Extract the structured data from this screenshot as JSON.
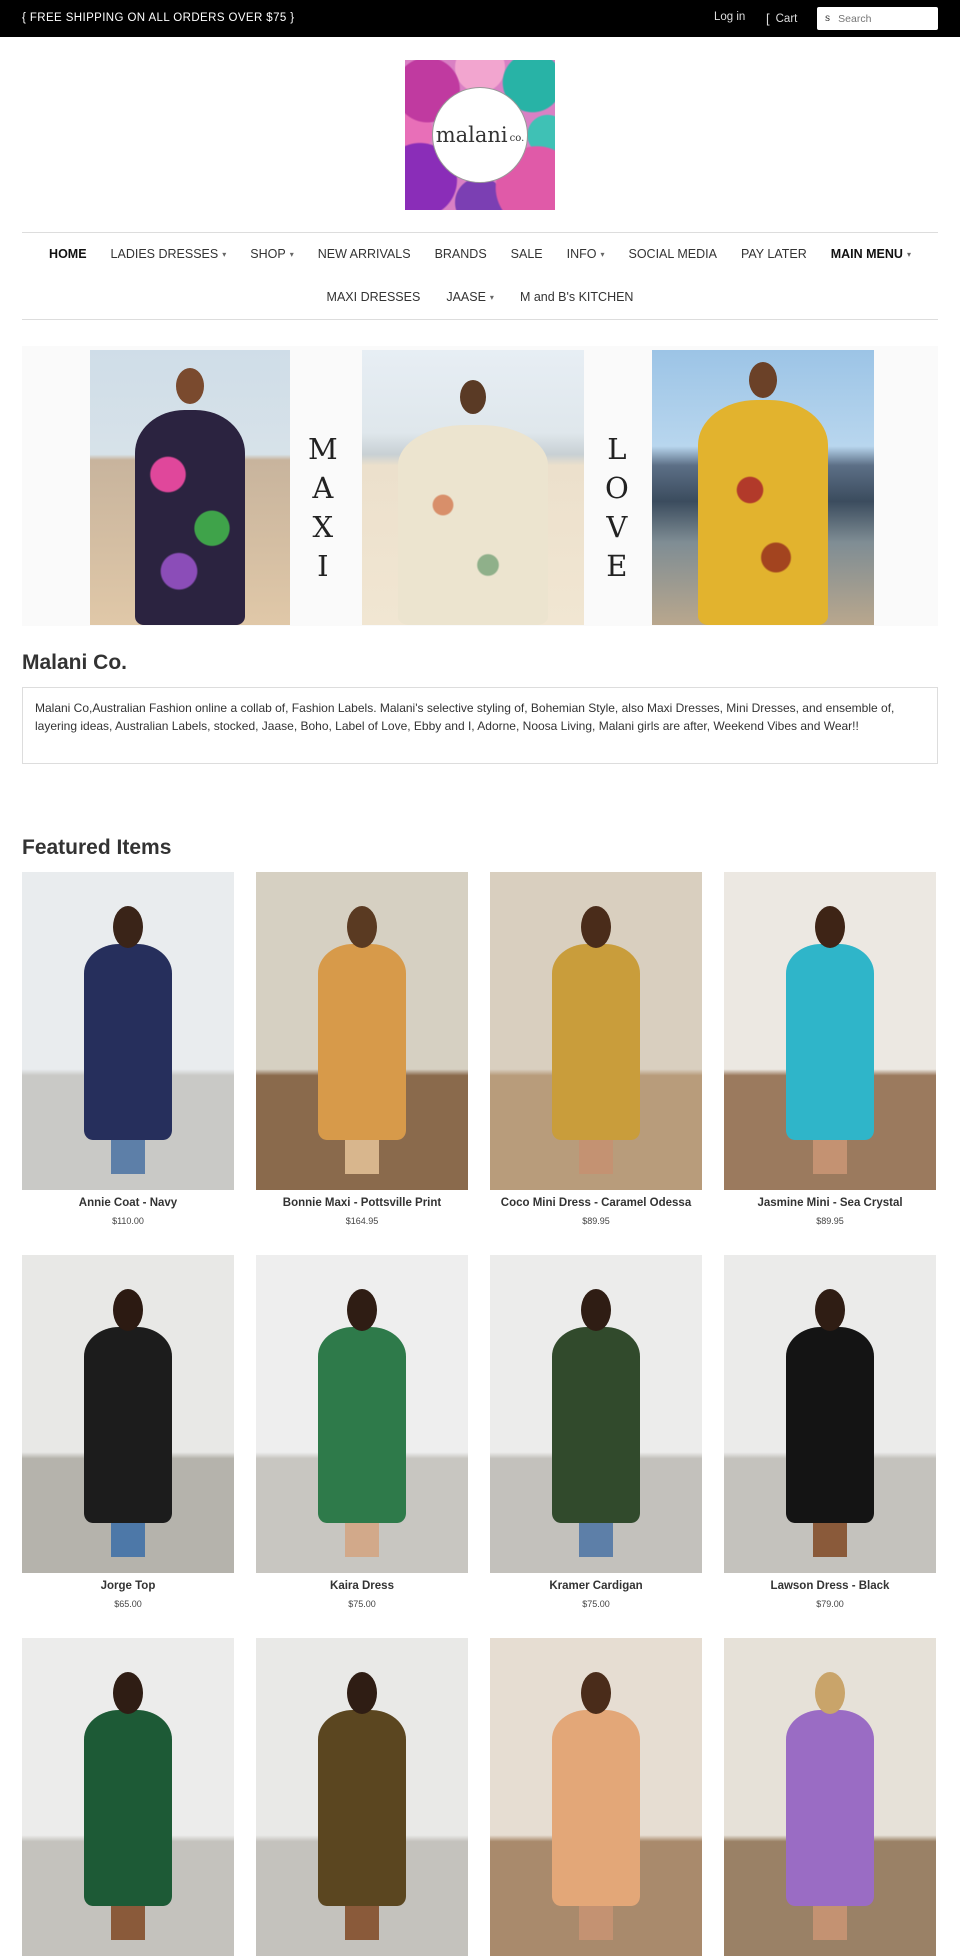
{
  "topbar": {
    "shipping": "{ FREE SHIPPING ON ALL ORDERS OVER $75 }",
    "login": "Log in",
    "cart": "Cart",
    "search_placeholder": "Search"
  },
  "logo": {
    "name": "malani",
    "suffix": "co."
  },
  "nav": {
    "row1": [
      {
        "label": "HOME",
        "caret": false,
        "bold": true
      },
      {
        "label": "LADIES DRESSES",
        "caret": true,
        "bold": false
      },
      {
        "label": "SHOP",
        "caret": true,
        "bold": false
      },
      {
        "label": "NEW ARRIVALS",
        "caret": false,
        "bold": false
      },
      {
        "label": "BRANDS",
        "caret": false,
        "bold": false
      },
      {
        "label": "SALE",
        "caret": false,
        "bold": false
      },
      {
        "label": "INFO",
        "caret": true,
        "bold": false
      },
      {
        "label": "SOCIAL MEDIA",
        "caret": false,
        "bold": false
      },
      {
        "label": "PAY LATER",
        "caret": false,
        "bold": false
      },
      {
        "label": "MAIN MENU",
        "caret": true,
        "bold": true
      }
    ],
    "row2": [
      {
        "label": "MAXI DRESSES",
        "caret": false,
        "bold": false
      },
      {
        "label": "JAASE",
        "caret": true,
        "bold": false
      },
      {
        "label": "M and B's KITCHEN",
        "caret": false,
        "bold": false
      }
    ],
    "caret_glyph": "▾"
  },
  "banner": {
    "word_left": [
      "M",
      "A",
      "X",
      "I"
    ],
    "word_right": [
      "L",
      "O",
      "V",
      "E"
    ]
  },
  "store": {
    "title": "Malani Co.",
    "description": "Malani Co,Australian Fashion online a collab of, Fashion Labels. Malani's selective styling of, Bohemian Style, also Maxi Dresses, Mini Dresses, and ensemble of, layering ideas,  Australian Labels, stocked, Jaase, Boho, Label of Love, Ebby and I, Adorne, Noosa Living, Malani girls are after, Weekend Vibes and Wear!!"
  },
  "featured": {
    "title": "Featured Items",
    "products": [
      {
        "name": "Annie Coat - Navy",
        "price": "$110.00",
        "garment": "#262f5c",
        "bg": "#e9ecee",
        "floor": "#c9c9c6",
        "hair": "#3a2418",
        "legs": "#5d7fa8"
      },
      {
        "name": "Bonnie Maxi - Pottsville Print",
        "price": "$164.95",
        "garment": "#d79a4a",
        "bg": "#d6d0c2",
        "floor": "#8a6a4c",
        "hair": "#5a3a22",
        "legs": "#d8b68d"
      },
      {
        "name": "Coco Mini Dress - Caramel Odessa",
        "price": "$89.95",
        "garment": "#c99d3b",
        "bg": "#d9cfbf",
        "floor": "#b89c7b",
        "hair": "#4a2c1a",
        "legs": "#c49272"
      },
      {
        "name": "Jasmine Mini - Sea Crystal",
        "price": "$89.95",
        "garment": "#2fb5c9",
        "bg": "#ece8e2",
        "floor": "#9b7a5e",
        "hair": "#3e2416",
        "legs": "#c49272"
      },
      {
        "name": "Jorge Top",
        "price": "$65.00",
        "garment": "#1c1c1c",
        "bg": "#e8e8e6",
        "floor": "#b5b3ac",
        "hair": "#2c1a12",
        "legs": "#4d78a8"
      },
      {
        "name": "Kaira Dress",
        "price": "$75.00",
        "garment": "#2e7a4a",
        "bg": "#eeeeee",
        "floor": "#c8c6c1",
        "hair": "#2f1d14",
        "legs": "#d2a98a"
      },
      {
        "name": "Kramer Cardigan",
        "price": "$75.00",
        "garment": "#314a2c",
        "bg": "#ececeb",
        "floor": "#c3c1bc",
        "hair": "#2f1d14",
        "legs": "#5d7fa8"
      },
      {
        "name": "Lawson Dress - Black",
        "price": "$79.00",
        "garment": "#141414",
        "bg": "#ebebea",
        "floor": "#c4c2bd",
        "hair": "#2f1d14",
        "legs": "#8a5a3a"
      },
      {
        "name": "",
        "price": "",
        "garment": "#1d5a36",
        "bg": "#ececeb",
        "floor": "#c4c2bd",
        "hair": "#2f1d14",
        "legs": "#8a5a3a"
      },
      {
        "name": "",
        "price": "",
        "garment": "#5b4620",
        "bg": "#e9e9e7",
        "floor": "#c4c2bd",
        "hair": "#2f1d14",
        "legs": "#8a5a3a"
      },
      {
        "name": "",
        "price": "",
        "garment": "#e3a778",
        "bg": "#e6ddd2",
        "floor": "#a98a6c",
        "hair": "#4a2c1a",
        "legs": "#c49272"
      },
      {
        "name": "",
        "price": "",
        "garment": "#9a6cc4",
        "bg": "#e6e1d8",
        "floor": "#9a8166",
        "hair": "#c9a46a",
        "legs": "#c49272"
      }
    ]
  }
}
